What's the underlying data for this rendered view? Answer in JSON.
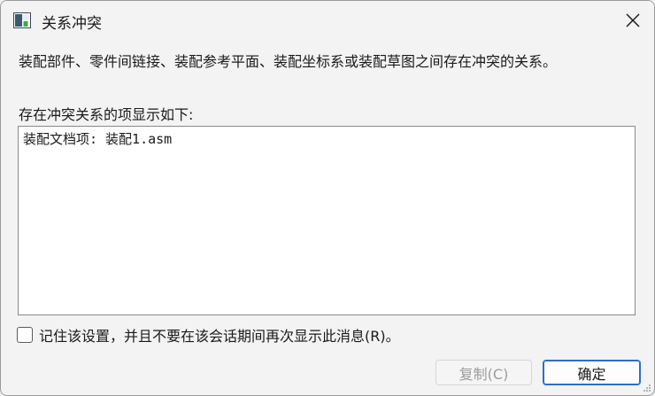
{
  "window": {
    "title": "关系冲突",
    "close_icon": "close-icon"
  },
  "message": "装配部件、零件间链接、装配参考平面、装配坐标系或装配草图之间存在冲突的关系。",
  "list": {
    "label": "存在冲突关系的项显示如下:",
    "items": [
      "装配文档项: 装配1.asm"
    ]
  },
  "checkbox": {
    "label": "记住该设置，并且不要在该会话期间再次显示此消息(R)。",
    "checked": false
  },
  "buttons": {
    "copy_label": "复制(C)",
    "ok_label": "确定"
  },
  "colors": {
    "accent": "#2f6bd0",
    "disabled_text": "#9c9c9c"
  }
}
